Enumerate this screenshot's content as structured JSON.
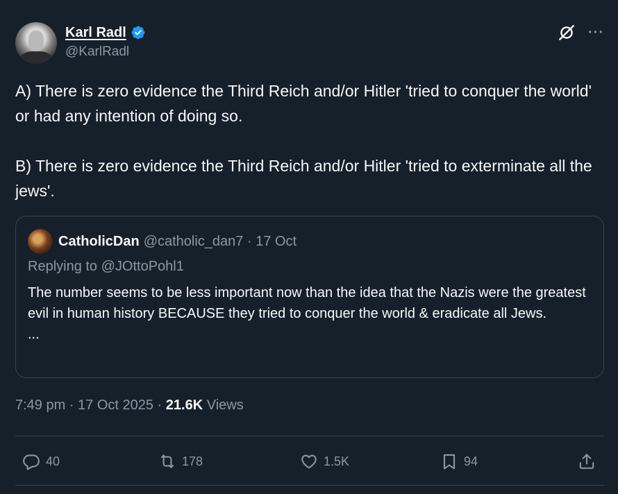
{
  "author": {
    "name": "Karl Radl",
    "handle": "@KarlRadl"
  },
  "icons": {
    "verified": "verified-badge-icon",
    "grok": "grok-icon",
    "more": "more-icon",
    "reply": "reply-icon",
    "retweet": "retweet-icon",
    "like": "like-icon",
    "bookmark": "bookmark-icon",
    "share": "share-icon"
  },
  "tweet": {
    "paragraphs": [
      "A) There is zero evidence the Third Reich and/or Hitler 'tried to conquer the world' or had any intention of doing so.",
      "B) There is zero evidence the Third Reich and/or Hitler 'tried to exterminate all the jews'."
    ]
  },
  "quote": {
    "name": "CatholicDan",
    "handle_date": "@catholic_dan7 · 17 Oct",
    "replying_to": "Replying to @JOttoPohl1",
    "text": "The number seems to be less important now than the idea that the Nazis were the greatest evil in human history BECAUSE they tried to conquer the world & eradicate all Jews.",
    "ellipsis": "..."
  },
  "meta": {
    "time_date": "7:49 pm · 17 Oct 2025 · ",
    "views_count": "21.6K",
    "views_label": " Views"
  },
  "actions": {
    "replies": "40",
    "retweets": "178",
    "likes": "1.5K",
    "bookmarks": "94"
  },
  "colors": {
    "background": "#15202b",
    "text": "#f7f9f9",
    "secondary_text": "#8b98a5",
    "border": "#38444d",
    "verified": "#1d9bf0"
  }
}
